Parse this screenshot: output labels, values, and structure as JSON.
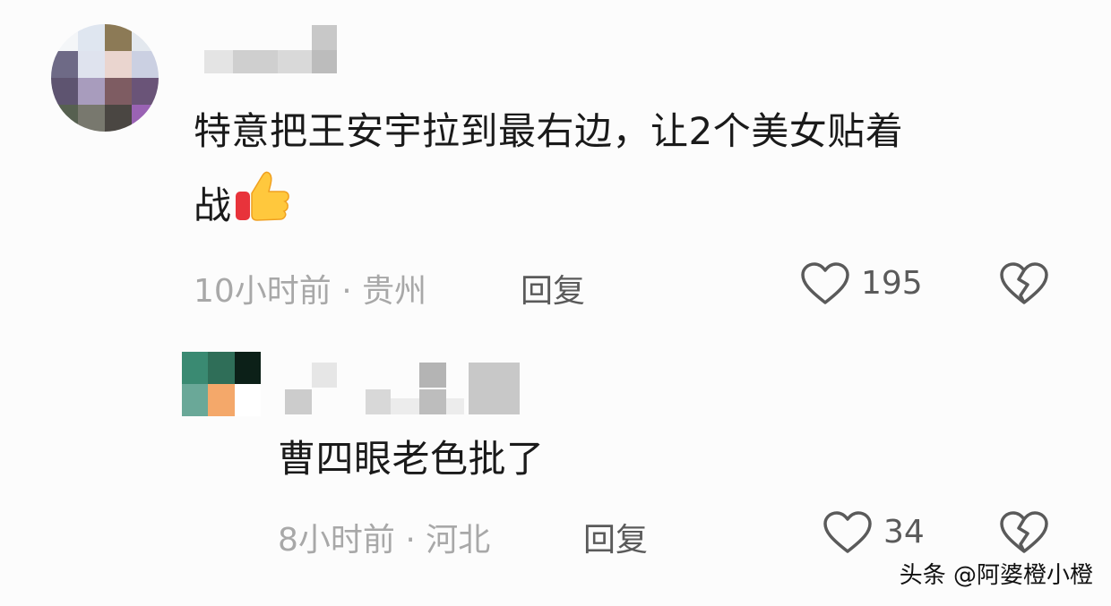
{
  "comments": [
    {
      "text_line1": "特意把王安宇拉到最右边，让2个美女贴着",
      "text_line2": "战",
      "emoji": "thumbs-up-icon",
      "time_location": "10小时前 · 贵州",
      "reply_label": "回复",
      "likes": "195"
    },
    {
      "text": "曹四眼老色批了",
      "time_location": "8小时前 · 河北",
      "reply_label": "回复",
      "likes": "34"
    }
  ],
  "watermark": "头条 @阿婆橙小橙",
  "icons": {
    "like": "heart-icon",
    "dislike": "broken-heart-icon"
  },
  "colors": {
    "meta_text": "#a8a8a8",
    "action_text": "#5a5a5a",
    "body_text": "#1a1a1a"
  }
}
